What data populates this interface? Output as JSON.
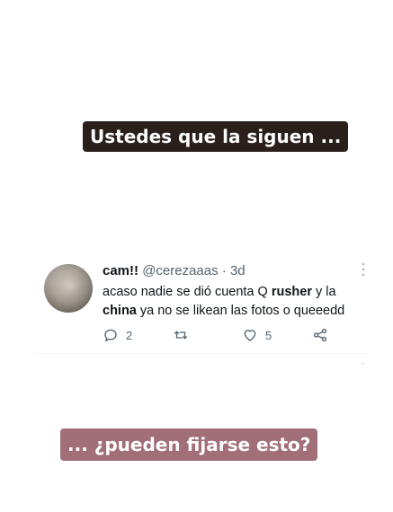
{
  "story": {
    "caption_top": "Ustedes que la siguen ...",
    "caption_bottom": "... ¿pueden fijarse esto?",
    "caption_top_bg": "#2a1f1b",
    "caption_bottom_bg": "#a26f79"
  },
  "tweet": {
    "display_name": "cam!!",
    "handle_time": "@cerezaaas · 3d",
    "more_icon": "vertical-ellipsis-icon",
    "text_1": "acaso nadie se dió cuenta Q ",
    "text_bold_1": "rusher",
    "text_2": " y la ",
    "text_bold_2": "china",
    "text_3": " ya no se likean las fotos o queeedd",
    "replies": "2",
    "retweets": "",
    "likes": "5",
    "icons": {
      "reply": "reply-bubble-icon",
      "retweet": "retweet-icon",
      "like": "heart-icon",
      "share": "share-icon"
    },
    "accent": "#536471"
  }
}
